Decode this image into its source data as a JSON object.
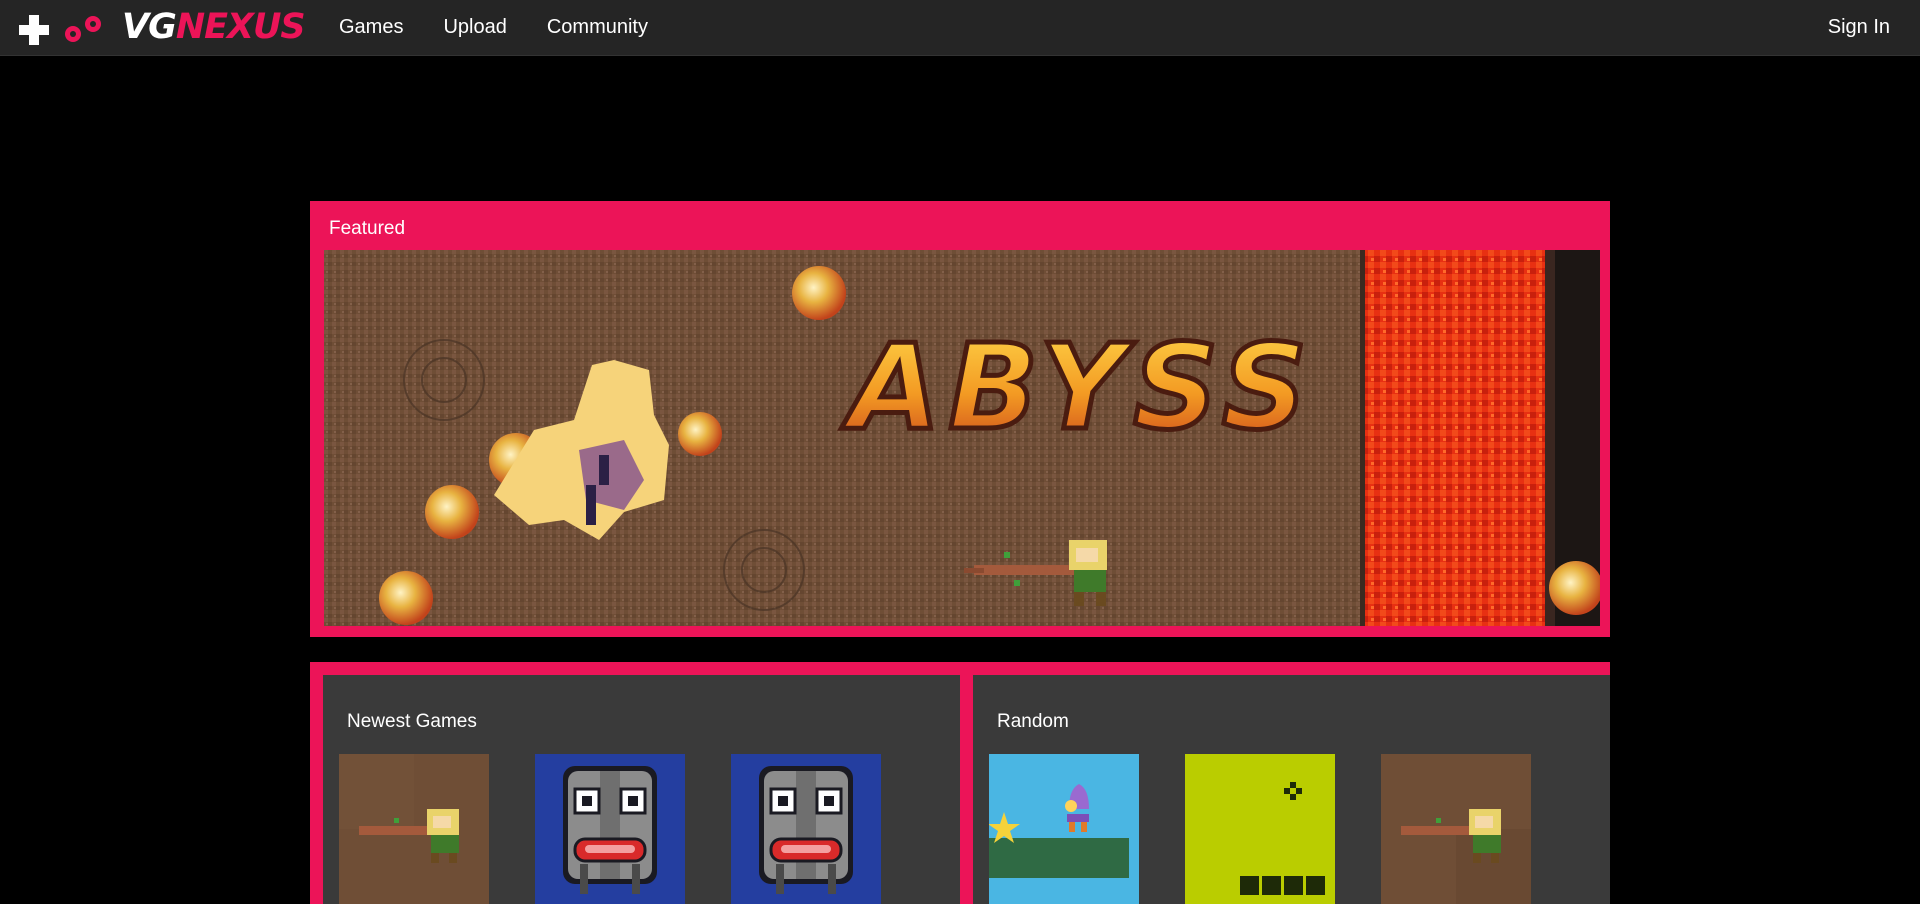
{
  "nav": {
    "logo": {
      "part1": "VG",
      "part2": "NEXUS"
    },
    "links": [
      "Games",
      "Upload",
      "Community"
    ],
    "sign_in": "Sign In"
  },
  "featured": {
    "title": "Featured",
    "game_title": "ABYSS"
  },
  "newest": {
    "title": "Newest Games",
    "thumbnails": [
      "abyss-thumbnail",
      "robot-thumbnail",
      "robot-thumbnail"
    ]
  },
  "random": {
    "title": "Random",
    "thumbnails": [
      "platformer-thumbnail",
      "gameboy-thumbnail",
      "abyss-thumbnail"
    ]
  },
  "colors": {
    "accent": "#ec1458",
    "navbar": "#252525",
    "panel": "#3a3a3a",
    "background": "#000000"
  }
}
